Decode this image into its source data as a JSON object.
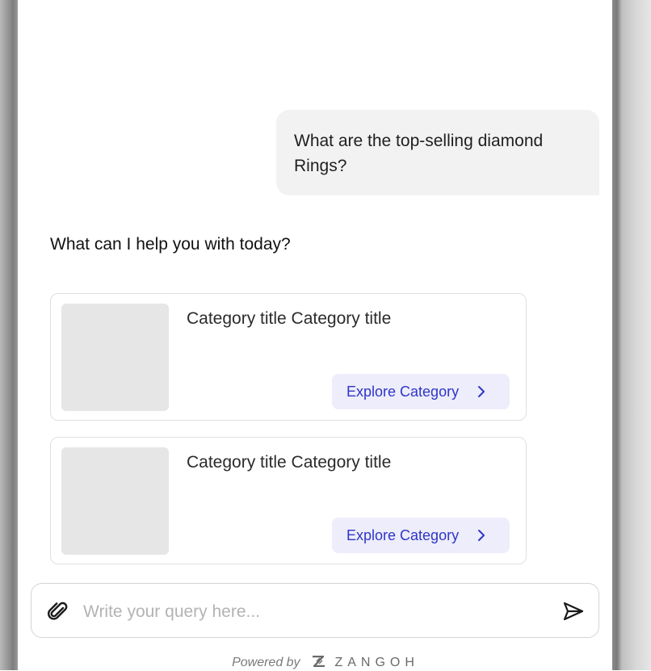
{
  "conversation": {
    "user_message": "What are the top-selling diamond Rings?",
    "bot_message": "What can I help you with today?"
  },
  "cards": [
    {
      "title": "Category title Category title",
      "button_label": "Explore Category"
    },
    {
      "title": "Category title Category title",
      "button_label": "Explore Category"
    }
  ],
  "composer": {
    "placeholder": "Write your query here...",
    "value": "",
    "attach_icon": "paperclip-icon",
    "send_icon": "send-icon"
  },
  "footer": {
    "powered_by": "Powered by",
    "brand": "ZANGOH"
  },
  "colors": {
    "accent": "#2f35c7",
    "button_bg": "#ededfb",
    "bubble_bg": "#f2f2f2"
  }
}
